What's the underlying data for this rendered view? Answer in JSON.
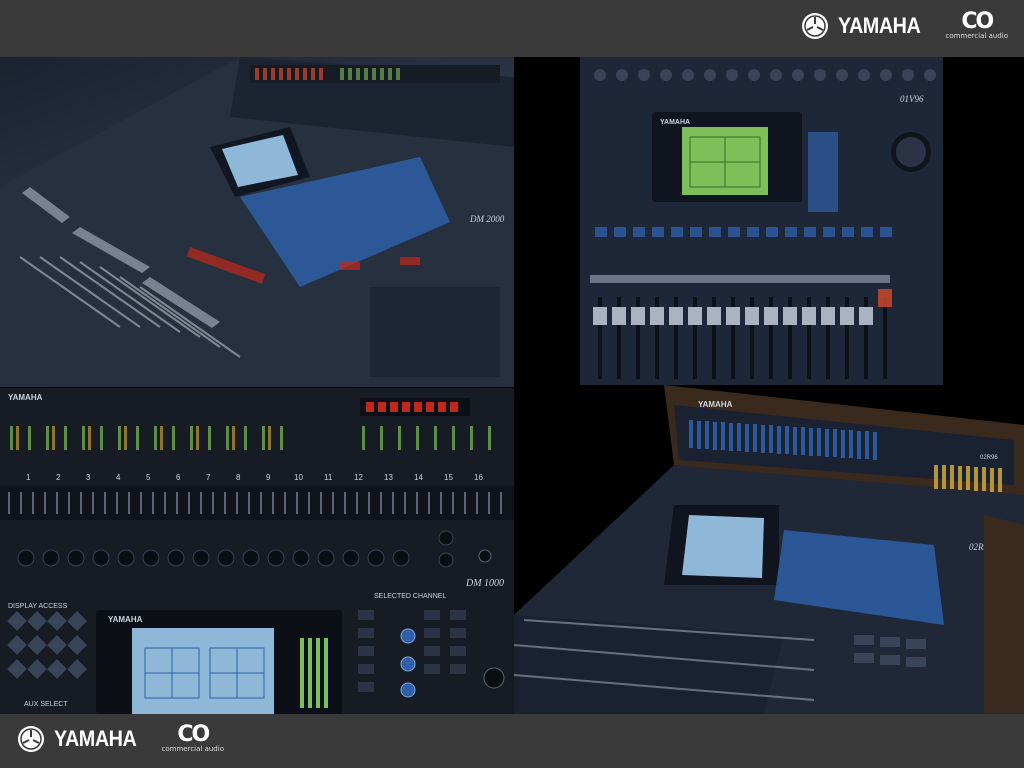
{
  "header": {
    "brand_name": "YAMAHA",
    "sub_brand_mark": "CO",
    "sub_brand_text": "commercial audio"
  },
  "footer": {
    "brand_name": "YAMAHA",
    "sub_brand_mark": "CO",
    "sub_brand_text": "commercial audio"
  },
  "photos": {
    "dm2000": {
      "model_label": "DM 2000"
    },
    "o1v96": {
      "model_label": "01V96",
      "brand_label": "YAMAHA"
    },
    "dm1000": {
      "model_label": "DM 1000",
      "brand_label": "YAMAHA",
      "display_access": "DISPLAY ACCESS",
      "aux_select": "AUX SELECT",
      "selected_channel": "SELECTED CHANNEL",
      "channel_numbers": [
        "1",
        "2",
        "3",
        "4",
        "5",
        "6",
        "7",
        "8",
        "9",
        "10",
        "11",
        "12",
        "13",
        "14",
        "15",
        "16"
      ]
    },
    "o2r96": {
      "brand_label": "YAMAHA",
      "model_label": "02R96"
    }
  },
  "colors": {
    "bar_bg": "#3a3a3a",
    "background": "#000000",
    "console_blue": "#2f5fa8",
    "screen": "#8fb8d8",
    "lcd_green": "#7fbf5a",
    "meter_led": "#d64a2a"
  }
}
